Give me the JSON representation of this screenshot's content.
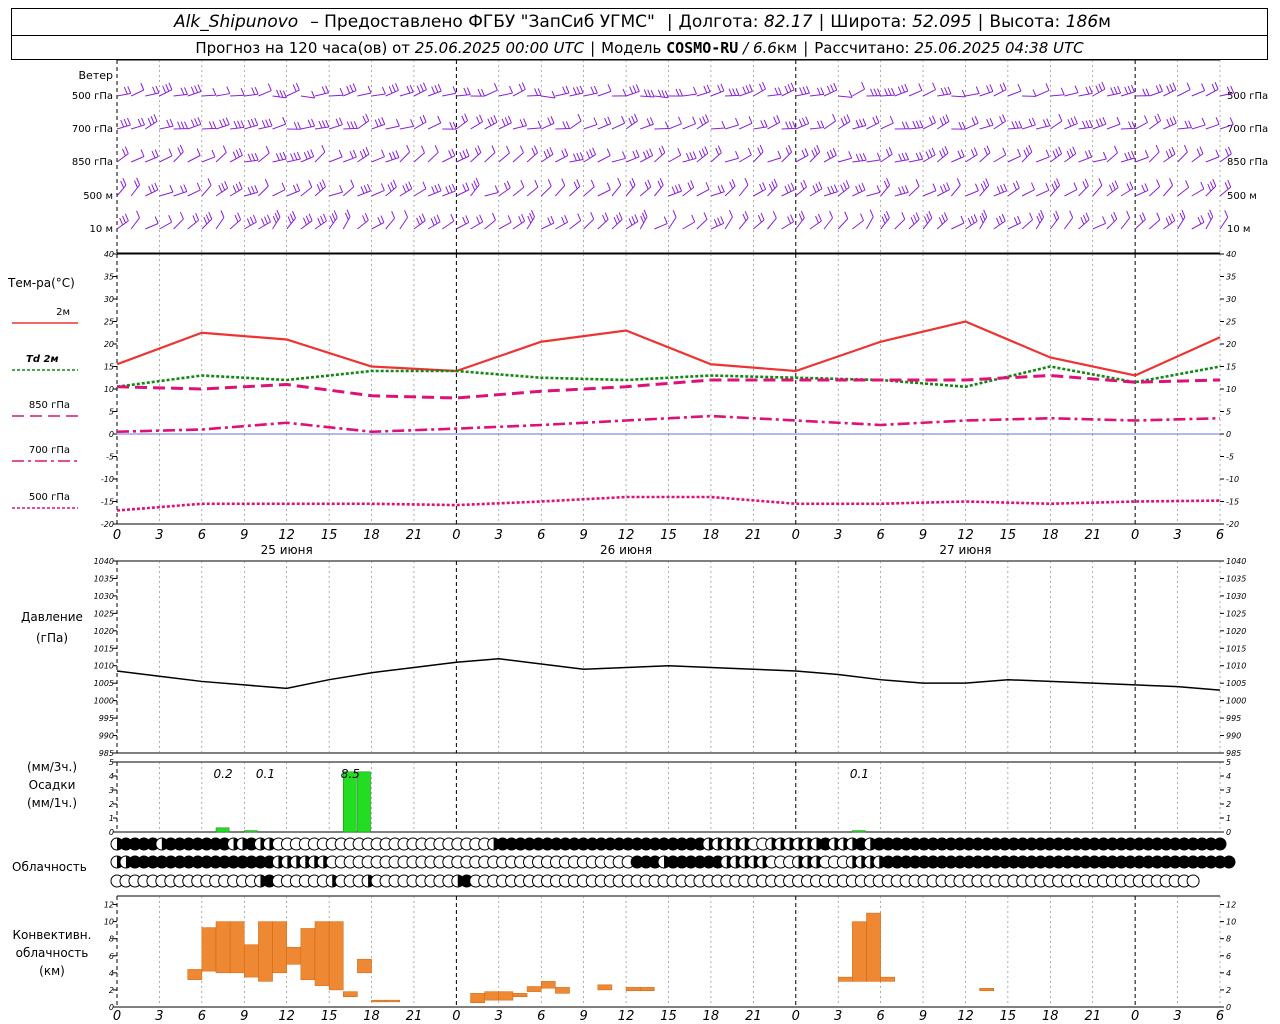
{
  "header": {
    "station": "Alk_Shipunovo",
    "provider": "– Предоставлено ФГБУ \"ЗапСиб УГМС\"",
    "lon_label": "Долгота:",
    "lon": "82.17",
    "lat_label": "Широта:",
    "lat": "52.095",
    "alt_label": "Высота:",
    "alt": "186",
    "alt_unit": "м",
    "forecast_label": "Прогноз на 120 часа(ов)",
    "from_label": "от",
    "run": "25.06.2025 00:00 UTC",
    "model_label": "Модель",
    "model": "COSMO-RU",
    "res": "/ 6.6",
    "res_unit": "км",
    "calc_label": "Рассчитано:",
    "calc": "25.06.2025 04:38 UTC"
  },
  "wind": {
    "title": "Ветер",
    "levels": [
      "500 гПа",
      "700 гПа",
      "850 гПа",
      "500 м",
      "10  м"
    ],
    "color": "#8b1fd6"
  },
  "temp_legend": {
    "title": "Тем-ра(°C)",
    "items": [
      {
        "label": "2м",
        "color": "#ee3333",
        "dash": ""
      },
      {
        "label": "Td  2м",
        "color": "#118811",
        "dash": "3,2"
      },
      {
        "label": "850 гПа",
        "color": "#dd1177",
        "dash": "12,6"
      },
      {
        "label": "700 гПа",
        "color": "#dd1177",
        "dash": "12,4,3,4"
      },
      {
        "label": "500 гПа",
        "color": "#dd1177",
        "dash": "3,2"
      }
    ]
  },
  "x_axis": {
    "ticks": [
      "0",
      "3",
      "6",
      "9",
      "12",
      "15",
      "18",
      "21",
      "0",
      "3",
      "6",
      "9",
      "12",
      "15",
      "18",
      "21",
      "0",
      "3",
      "6",
      "9",
      "12",
      "15",
      "18",
      "21",
      "0",
      "3",
      "6"
    ],
    "dates": [
      "25 июня",
      "26 июня",
      "27 июня"
    ]
  },
  "pressure_label": [
    "Давление",
    "(гПа)"
  ],
  "precip_label": [
    "(мм/3ч.)",
    "Осадки",
    "(мм/1ч.)"
  ],
  "precip_annotations": [
    "0.2",
    "0.1",
    "8.5",
    "0.1"
  ],
  "cloud_label": "Облачность",
  "conv_label": [
    "Конвективн.",
    "облачность",
    "(км)"
  ],
  "chart_data": [
    {
      "type": "line",
      "title": "Тем-ра(°C)",
      "x_unit": "hours from 25.06.2025 00:00 UTC",
      "ylim": [
        -20,
        40
      ],
      "yticks": [
        -20,
        -15,
        -10,
        -5,
        0,
        5,
        10,
        15,
        20,
        25,
        30,
        35,
        40
      ],
      "x": [
        0,
        6,
        12,
        18,
        24,
        30,
        36,
        42,
        48,
        54,
        60,
        66,
        72,
        78
      ],
      "series": [
        {
          "name": "2м",
          "values": [
            15.5,
            22.5,
            21,
            15,
            14,
            20.5,
            23,
            15.5,
            14,
            20.5,
            25,
            17,
            13,
            21.5
          ]
        },
        {
          "name": "Td  2м",
          "values": [
            10.5,
            13,
            12,
            14,
            14,
            12.5,
            12,
            13,
            12.5,
            12,
            10.5,
            15,
            11.5,
            15
          ]
        },
        {
          "name": "850 гПа",
          "values": [
            10.5,
            10,
            11,
            8.5,
            8,
            9.5,
            10.5,
            12,
            12,
            12,
            12,
            13,
            11.5,
            12
          ]
        },
        {
          "name": "700 гПа",
          "values": [
            0.5,
            1,
            2.5,
            0.5,
            1.2,
            2,
            3,
            4,
            3,
            2,
            3,
            3.5,
            3,
            3.5
          ]
        },
        {
          "name": "500 гПа",
          "values": [
            -17,
            -15.5,
            -15.5,
            -15.5,
            -15.8,
            -15,
            -14,
            -14,
            -15.5,
            -15.5,
            -15,
            -15.5,
            -15,
            -14.8
          ]
        }
      ]
    },
    {
      "type": "line",
      "title": "Давление (гПа)",
      "ylim": [
        985,
        1040
      ],
      "yticks": [
        985,
        990,
        995,
        1000,
        1005,
        1010,
        1015,
        1020,
        1025,
        1030,
        1035,
        1040
      ],
      "x": [
        0,
        3,
        6,
        9,
        12,
        15,
        18,
        21,
        24,
        27,
        30,
        33,
        36,
        39,
        42,
        45,
        48,
        51,
        54,
        57,
        60,
        63,
        66,
        69,
        72,
        75,
        78
      ],
      "series": [
        {
          "name": "",
          "values": [
            1008.5,
            1007,
            1005.5,
            1004.5,
            1003.5,
            1006,
            1008,
            1009.5,
            1011,
            1012,
            1010.5,
            1009,
            1009.5,
            1010,
            1009.5,
            1009,
            1008.5,
            1007.5,
            1006,
            1005,
            1005,
            1006,
            1005.5,
            1005,
            1004.5,
            1004,
            1003
          ]
        }
      ]
    },
    {
      "type": "bar",
      "title": "Осадки (мм/3ч.) (мм/1ч.)",
      "ylim": [
        0,
        5
      ],
      "yticks": [
        0,
        1,
        2,
        3,
        4,
        5
      ],
      "x": [
        7,
        9,
        16,
        17,
        52
      ],
      "values": [
        0.3,
        0.1,
        4.3,
        4.3,
        0.1
      ]
    },
    {
      "type": "bar",
      "title": "Конвективн. облачность (км)",
      "ylim": [
        0,
        13
      ],
      "yticks": [
        0,
        2,
        4,
        6,
        8,
        10,
        12
      ],
      "x": [
        5,
        6,
        7,
        8,
        9,
        10,
        11,
        12,
        13,
        14,
        15,
        16,
        17,
        18,
        19,
        25,
        26,
        27,
        28,
        29,
        30,
        31,
        34,
        36,
        37,
        51,
        52,
        53,
        54,
        61
      ],
      "series": [
        {
          "name": "base",
          "values": [
            3.2,
            4.2,
            4.0,
            4.0,
            3.5,
            3.0,
            4.0,
            5.0,
            3.2,
            2.5,
            2.0,
            1.2,
            4.0,
            0.6,
            0.6,
            0.5,
            0.8,
            0.8,
            1.2,
            1.8,
            2.2,
            1.6,
            2.0,
            1.9,
            1.9,
            3.0,
            3.0,
            3.0,
            3.0,
            1.9
          ]
        },
        {
          "name": "top",
          "values": [
            4.4,
            9.3,
            10.0,
            10.0,
            7.3,
            10.0,
            10.0,
            7.0,
            9.2,
            10.0,
            10.0,
            1.8,
            5.6,
            0.8,
            0.8,
            1.6,
            1.8,
            1.8,
            1.6,
            2.4,
            3.0,
            2.3,
            2.6,
            2.3,
            2.3,
            3.5,
            10.0,
            11.0,
            3.5,
            2.2
          ]
        }
      ]
    },
    {
      "type": "table",
      "title": "Облачность",
      "rows": [
        {
          "name": "upper",
          "values": [
            0.5,
            1,
            1,
            1,
            1,
            0.5,
            1,
            1,
            1,
            1,
            1,
            1,
            1,
            0.5,
            0.5,
            1,
            0.5,
            0.5,
            0,
            0,
            0,
            0,
            0,
            0,
            0,
            0,
            0,
            0,
            0,
            0,
            0,
            0,
            0,
            0,
            0,
            0,
            0,
            0,
            0,
            0,
            0,
            0,
            0.5,
            1,
            1,
            1,
            1,
            1,
            1,
            1,
            1,
            1,
            1,
            1,
            1,
            1,
            1,
            1,
            1,
            1,
            1,
            1,
            1,
            1,
            1,
            1,
            0.5,
            0.5,
            0.5,
            0.5,
            0.5,
            0,
            0,
            0.5,
            0.5,
            0.5,
            0.5,
            0.5,
            0.5,
            1,
            0.5,
            0.5,
            0.5,
            1,
            0.5,
            1,
            1,
            1,
            1,
            1,
            1,
            1,
            1,
            1,
            1,
            1,
            1,
            1,
            1,
            1,
            1,
            1,
            1,
            1,
            1,
            1,
            1,
            1,
            1,
            1,
            1,
            1,
            1,
            1,
            1,
            1,
            1,
            1,
            1,
            1,
            1,
            1,
            1,
            1
          ]
        },
        {
          "name": "middle",
          "values": [
            0.5,
            0.5,
            1,
            1,
            1,
            1,
            1,
            1,
            1,
            1,
            1,
            1,
            1,
            1,
            1,
            1,
            1,
            1,
            0.5,
            0.5,
            0.5,
            0.5,
            0.5,
            0.5,
            0,
            0,
            0,
            0,
            0,
            0,
            0,
            0,
            0,
            0,
            0,
            0,
            0,
            0,
            0,
            0,
            0,
            0,
            0,
            0,
            0,
            0,
            0,
            0,
            0,
            0,
            0,
            0,
            0,
            0,
            0,
            0,
            0,
            0,
            1,
            1,
            1,
            0.5,
            1,
            1,
            1,
            1,
            1,
            1,
            0.5,
            0.5,
            0.5,
            0.5,
            0.5,
            0,
            0,
            0,
            0.5,
            0.5,
            0.5,
            0,
            0,
            0,
            0.5,
            0.5,
            0.5,
            0.5,
            1,
            1,
            1,
            1,
            1,
            1,
            1,
            1,
            1,
            1,
            1,
            1,
            1,
            1,
            1,
            1,
            1,
            1,
            1,
            1,
            1,
            1,
            1,
            1,
            1,
            1,
            1,
            1,
            1,
            1,
            1,
            1,
            1,
            1,
            1,
            1,
            1,
            1,
            1
          ]
        },
        {
          "name": "lower",
          "values": [
            0,
            0,
            0,
            0,
            0,
            0,
            0,
            0,
            0,
            0,
            0,
            0,
            0,
            0,
            0,
            0,
            0.5,
            1,
            0,
            0,
            0,
            0,
            0,
            0,
            0.5,
            0,
            0,
            0,
            0.5,
            0,
            0,
            0,
            0,
            0,
            0,
            0,
            0,
            0,
            0.5,
            1,
            0,
            0,
            0,
            0,
            0,
            0,
            0,
            0,
            0,
            0,
            0,
            0,
            0,
            0,
            0,
            0,
            0,
            0,
            0,
            0,
            0,
            0,
            0,
            0,
            0,
            0,
            0,
            0,
            0,
            0,
            0,
            0,
            0,
            0,
            0,
            0,
            0,
            0,
            0,
            0,
            0,
            0,
            0,
            0,
            0,
            0,
            0,
            0,
            0,
            0,
            0,
            0,
            0,
            0,
            0,
            0,
            0,
            0,
            0,
            0,
            0,
            0,
            0,
            0,
            0,
            0,
            0,
            0,
            0,
            0,
            0,
            0,
            0,
            0,
            0,
            0,
            0,
            0,
            0,
            0,
            0
          ]
        }
      ]
    }
  ]
}
